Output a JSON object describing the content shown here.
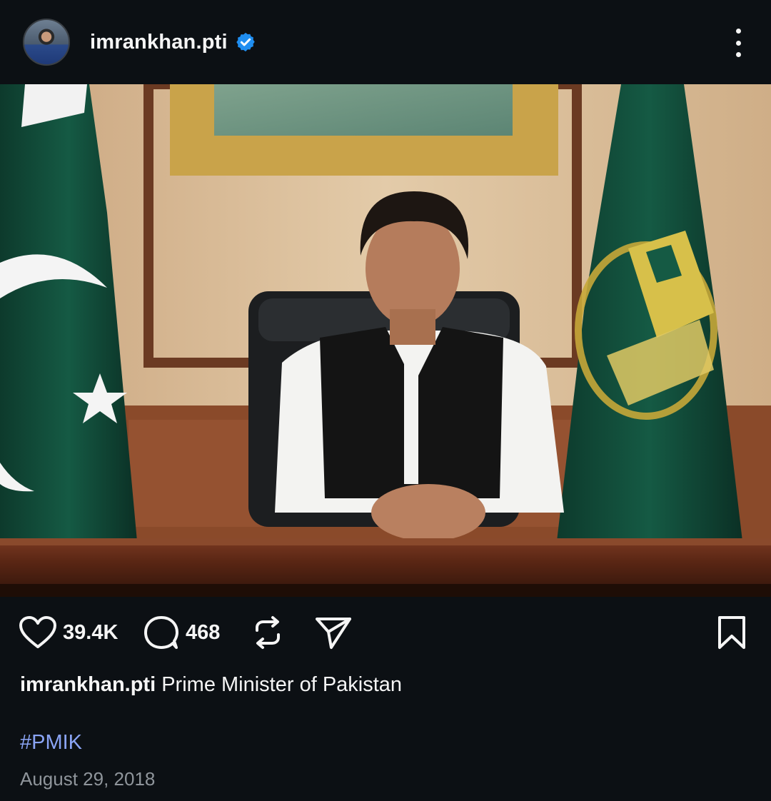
{
  "header": {
    "username": "imrankhan.pti",
    "verified": true,
    "avatar_icon": "profile-avatar",
    "more_icon": "more-vertical-icon"
  },
  "post": {
    "image_icon": "post-photo"
  },
  "actions": {
    "likes": "39.4K",
    "comments": "468",
    "like_icon": "heart-icon",
    "comment_icon": "comment-icon",
    "repost_icon": "repost-icon",
    "share_icon": "send-icon",
    "save_icon": "bookmark-icon"
  },
  "caption": {
    "username": "imrankhan.pti",
    "text": "Prime Minister of Pakistan",
    "hashtag": "#PMIK",
    "date": "August 29, 2018"
  },
  "colors": {
    "background": "#0c1014",
    "text": "#f5f5f5",
    "hashtag": "#8aa4f5",
    "date": "#8f959b",
    "verified": "#1f8ef1"
  }
}
